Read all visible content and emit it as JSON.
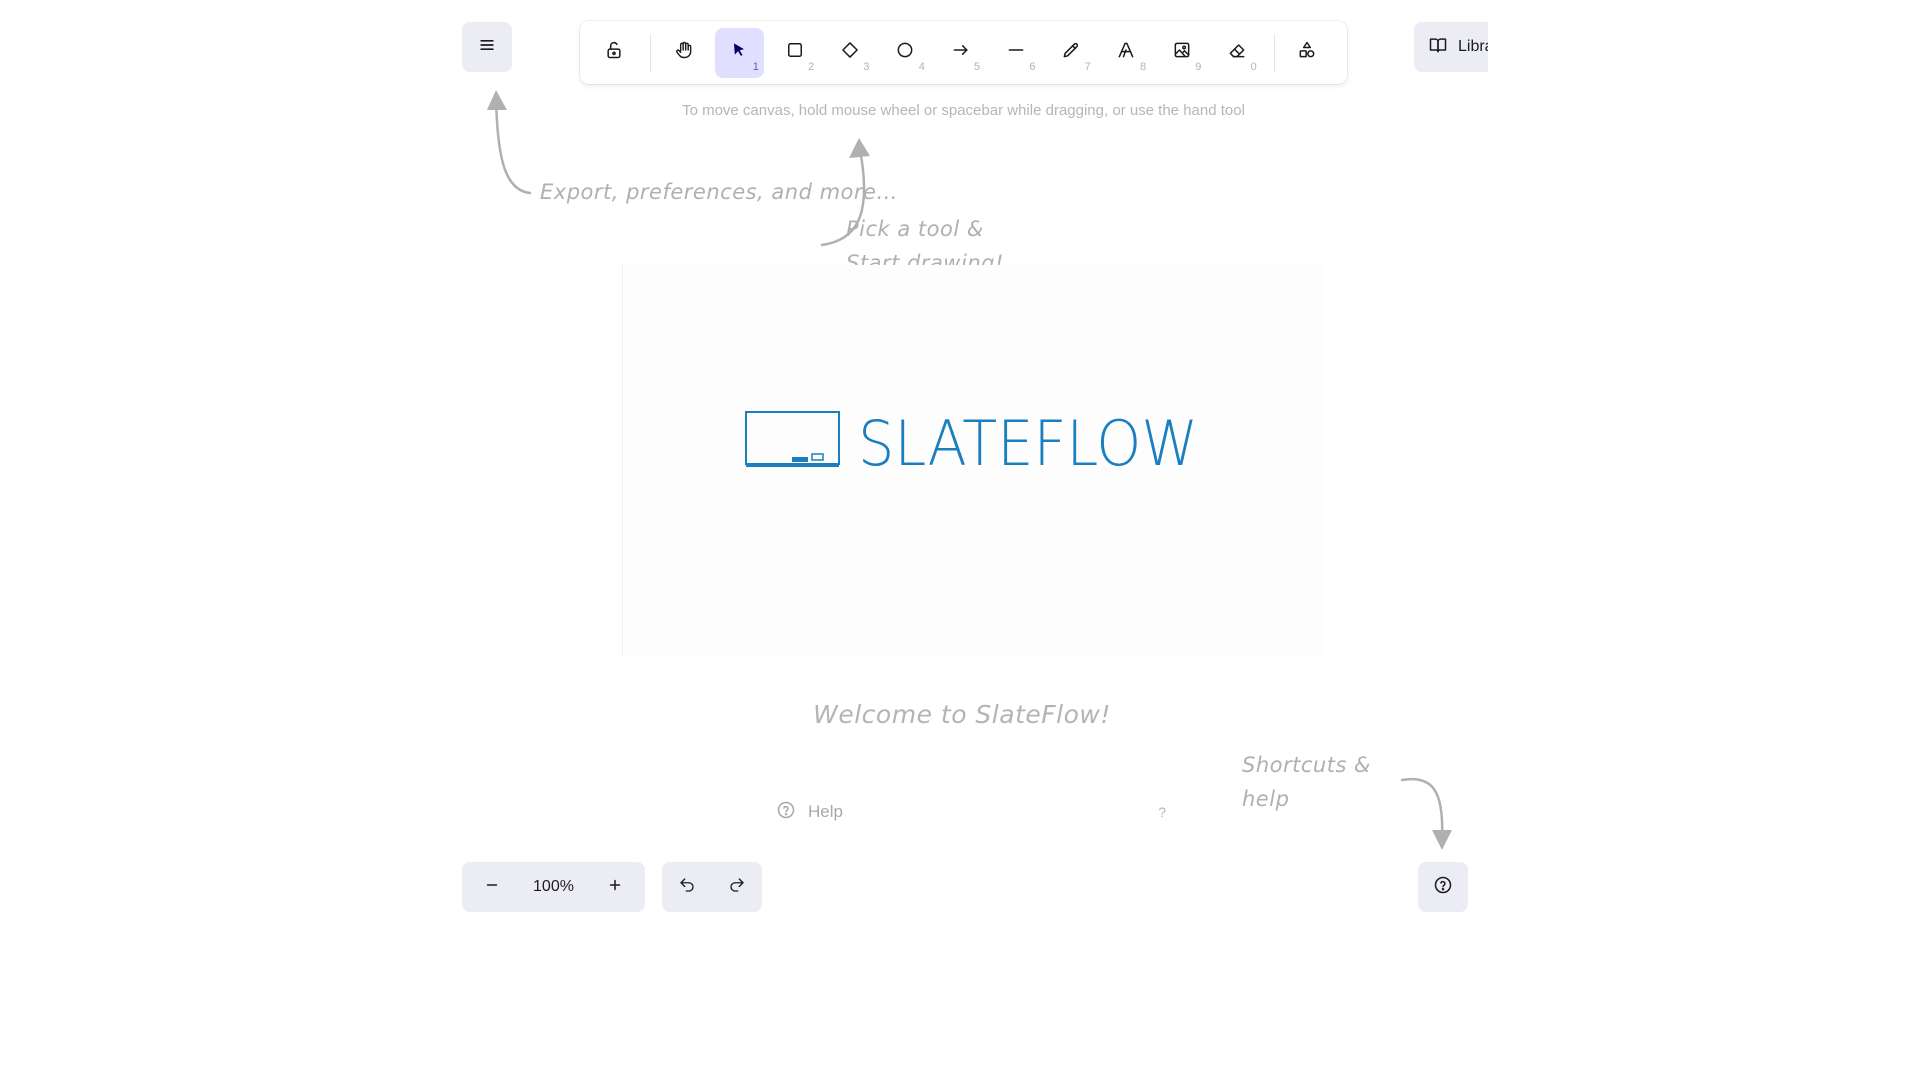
{
  "toolbar": {
    "tools": [
      {
        "name": "lock-icon",
        "key": ""
      },
      {
        "name": "hand-icon",
        "key": ""
      },
      {
        "name": "selection-icon",
        "key": "1"
      },
      {
        "name": "rectangle-icon",
        "key": "2"
      },
      {
        "name": "diamond-icon",
        "key": "3"
      },
      {
        "name": "ellipse-icon",
        "key": "4"
      },
      {
        "name": "arrow-icon",
        "key": "5"
      },
      {
        "name": "line-icon",
        "key": "6"
      },
      {
        "name": "pencil-icon",
        "key": "7"
      },
      {
        "name": "text-icon",
        "key": "8"
      },
      {
        "name": "image-icon",
        "key": "9"
      },
      {
        "name": "eraser-icon",
        "key": "0"
      },
      {
        "name": "shapes-icon",
        "key": ""
      }
    ],
    "active_tool": "selection-icon",
    "library_label": "Library"
  },
  "hint": "To move canvas, hold mouse wheel or spacebar while dragging, or use the hand tool",
  "hints": {
    "menu": "Export, preferences, and more...",
    "toolbar_line1": "Pick a tool &",
    "toolbar_line2": "Start drawing!",
    "help_line1": "Shortcuts &",
    "help_line2": "help"
  },
  "welcome": {
    "logo_text": "SLATEFLOW",
    "title": "Welcome to SlateFlow!",
    "help_label": "Help",
    "help_shortcut": "?"
  },
  "footer": {
    "zoom": "100%"
  },
  "colors": {
    "accent": "#e0dfff",
    "accent_dark": "#030064",
    "logo_blue": "#1b7fbf",
    "island_bg": "#ececf4",
    "hint_gray": "#b0b0b0"
  }
}
